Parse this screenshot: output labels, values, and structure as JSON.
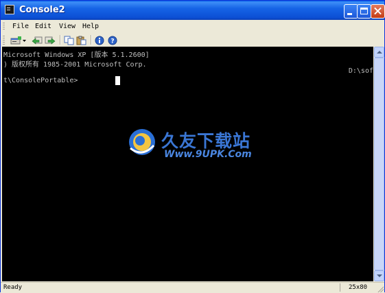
{
  "window": {
    "title": "Console2"
  },
  "menu": {
    "items": [
      "File",
      "Edit",
      "View",
      "Help"
    ]
  },
  "toolbar": {
    "buttons": [
      "new-tab-icon",
      "dropdown-arrow-icon",
      "back-icon",
      "forward-icon",
      "copy-icon",
      "paste-icon",
      "info-icon",
      "help-icon"
    ]
  },
  "console": {
    "lines": [
      "Microsoft Windows XP [版本 5.1.2600]",
      ") 版权所有 1985-2001 Microsoft Corp.",
      "D:\\sof",
      "t\\ConsolePortable>"
    ]
  },
  "watermark": {
    "title": "久友下载站",
    "url": "Www.9UPK.Com"
  },
  "status": {
    "text": "Ready",
    "size": "25x80"
  },
  "colors": {
    "titlebar": "#0c4fd4",
    "console_bg": "#000000",
    "console_text": "#c0c0c0"
  }
}
